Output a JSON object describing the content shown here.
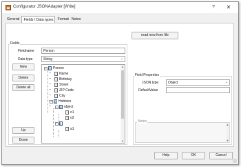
{
  "window": {
    "title": "Configurator JSONAdapter [Write]",
    "help_glyph": "?",
    "close_glyph": "✕"
  },
  "tabs": [
    {
      "label": "General",
      "active": false
    },
    {
      "label": "Fields / Data types",
      "active": true
    },
    {
      "label": "Format",
      "active": false
    },
    {
      "label": "Notes",
      "active": false
    }
  ],
  "read_new_button": "read new from file",
  "fields_group": {
    "label": "Fields",
    "fieldname_label": "Fieldname",
    "fieldname_value": "Person",
    "datatype_label": "Data type",
    "datatype_value": "String",
    "buttons": {
      "new": "New",
      "delete": "Delete",
      "delete_all": "Delete all",
      "up": "Up",
      "down": "Down"
    }
  },
  "tree": [
    {
      "label": "Person",
      "icon": "object-icon",
      "level": 0,
      "expanded": true
    },
    {
      "label": "Name",
      "icon": "property-icon",
      "level": 1
    },
    {
      "label": "Birthday",
      "icon": "property-icon",
      "level": 1
    },
    {
      "label": "Street",
      "icon": "property-icon",
      "level": 1
    },
    {
      "label": "ZIP Code",
      "icon": "property-icon",
      "level": 1
    },
    {
      "label": "City",
      "icon": "property-icon",
      "level": 1
    },
    {
      "label": "Hobbies",
      "icon": "array-icon",
      "level": 1,
      "expanded": true
    },
    {
      "label": "object",
      "icon": "object-icon",
      "level": 2,
      "expanded": true
    },
    {
      "label": "o1",
      "icon": "property-icon",
      "level": 3
    },
    {
      "label": "o2",
      "icon": "property-icon",
      "level": 3
    },
    {
      "label": "",
      "icon": "array-icon",
      "level": 2,
      "expanded": true
    },
    {
      "label": "a1",
      "icon": "property-icon",
      "level": 3
    }
  ],
  "field_properties": {
    "label": "Field Properties",
    "json_type_label": "JSON type",
    "json_type_value": "Object",
    "default_value_label": "DefaultValue",
    "default_value": "",
    "notes_label": "Notes"
  },
  "footer": {
    "help": "Help",
    "ok": "OK",
    "cancel": "Cancel"
  }
}
